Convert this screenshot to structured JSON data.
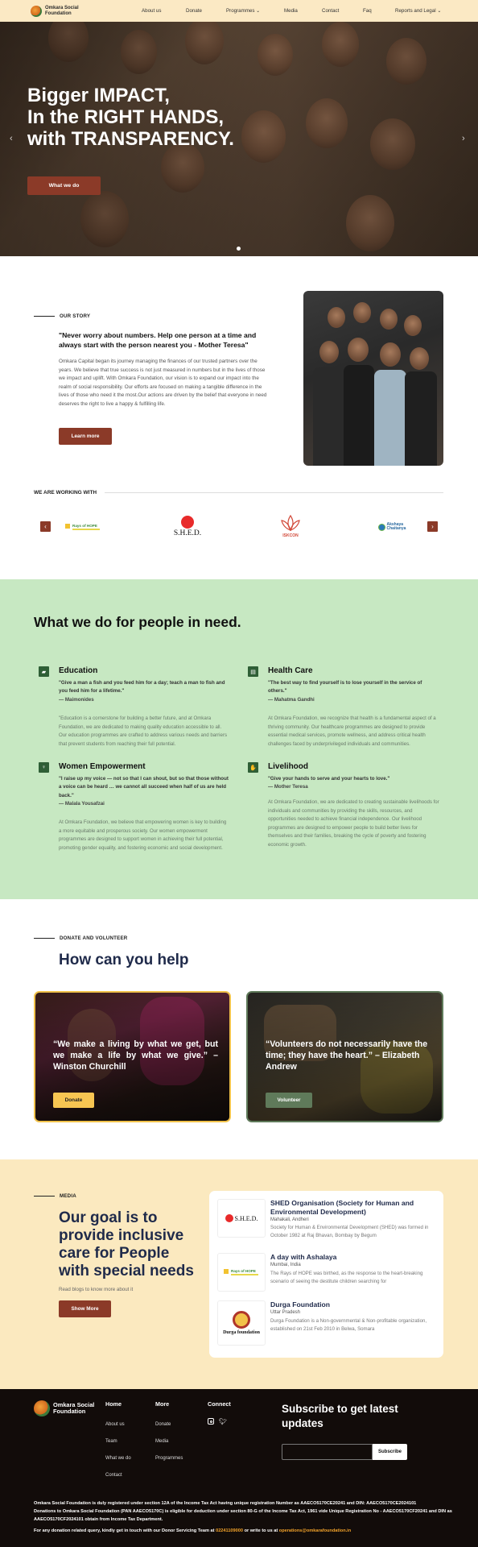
{
  "nav": {
    "logo_text": "Omkara Social Foundation",
    "items": [
      {
        "label": "About us"
      },
      {
        "label": "Donate"
      },
      {
        "label": "Programmes",
        "has_dropdown": true
      },
      {
        "label": "Media"
      },
      {
        "label": "Contact"
      },
      {
        "label": "Faq"
      },
      {
        "label": "Reports and Legal",
        "has_dropdown": true
      }
    ]
  },
  "hero": {
    "headline_1": "Bigger IMPACT,",
    "headline_2": "In the RIGHT HANDS,",
    "headline_3": "with TRANSPARENCY.",
    "cta": "What we do",
    "slides_total": 1,
    "active_slide": 1
  },
  "story": {
    "eyebrow": "OUR STORY",
    "quote": "\"Never worry about numbers. Help one person at a time and always start with the person nearest you - Mother Teresa\"",
    "body": "Omkara Capital began its journey managing the finances of our trusted partners over the years. We believe that true success is not just measured in numbers but in the lives of those we impact and uplift. With Omkara Foundation, our vision is to expand our impact into the realm of social responsibility. Our efforts are focused on making a tangible difference in the lives of those who need it the most.Our actions are driven by the belief that everyone in need deserves the right to live a happy & fulfilling life.",
    "button": "Learn more"
  },
  "partners": {
    "heading": "WE ARE WORKING WITH",
    "items": [
      {
        "name": "Rays of HOPE"
      },
      {
        "name": "S.H.E.D."
      },
      {
        "name": "ISKCON"
      },
      {
        "name": "Akshaya Chaitanya"
      }
    ]
  },
  "what_we_do": {
    "title": "What we do for people in need.",
    "areas": [
      {
        "title": "Education",
        "icon": "book-icon",
        "quote": "\"Give a man a fish and you feed him for a day; teach a man to fish and you feed him for a lifetime.\"",
        "author": "— Maimonides",
        "desc": "\"Education is a cornerstone for building a better future, and at Omkara Foundation, we are dedicated to making quality education accessible to all. Our education programmes are crafted to address various needs and barriers that prevent students from reaching their full potential."
      },
      {
        "title": "Health Care",
        "icon": "medical-kit-icon",
        "quote": "\"The best way to find yourself is to lose yourself in the service of others.\"",
        "author": "— Mahatma Gandhi",
        "desc": "At Omkara Foundation, we recognize that health is a fundamental aspect of a thriving community. Our healthcare programmes are designed to provide essential medical services, promote wellness, and address critical health challenges faced by underprivileged individuals and communities."
      },
      {
        "title": "Women Empowerment",
        "icon": "woman-icon",
        "quote": "\"I raise up my voice — not so that I can shout, but so that those without a voice can be heard … we cannot all succeed when half of us are held back.\"",
        "author": "— Malala Yousafzai",
        "desc": "At Omkara Foundation, we believe that empowering women is key to building a more equitable and prosperous society. Our women empowerment programmes are designed to support women in achieving their full potential, promoting gender equality, and fostering economic and social development."
      },
      {
        "title": "Livelihood",
        "icon": "hand-icon",
        "quote": "\"Give your hands to serve and your hearts to love.\"",
        "author": "— Mother Teresa",
        "desc": "At Omkara Foundation, we are dedicated to creating sustainable livelihoods for individuals and communities by providing the skills, resources, and opportunities needed to achieve financial independence. Our livelihood programmes are designed to empower people to build better lives for themselves and their families, breaking the cycle of poverty and fostering economic growth."
      }
    ]
  },
  "help": {
    "eyebrow": "DONATE AND VOLUNTEER",
    "title": "How can you help",
    "cards": [
      {
        "quote": "“We make a living by what we get, but we make a life by what we give.” – Winston Churchill",
        "button": "Donate"
      },
      {
        "quote": "“Volunteers do not necessarily have the time; they have the heart.” – Elizabeth Andrew",
        "button": "Volunteer"
      }
    ]
  },
  "media": {
    "eyebrow": "MEDIA",
    "title": "Our goal is to provide inclusive care for People with special needs",
    "subtitle": "Read blogs to know more about it",
    "button": "Show More",
    "posts": [
      {
        "logo": "S.H.E.D.",
        "title": "SHED Organisation (Society for Human and Environmental Development)",
        "location": "Mahakali, Andheri",
        "excerpt": "Society for Human & Environmental Development (SHED) was formed in October 1982 at Raj Bhavan, Bombay by Begum"
      },
      {
        "logo": "Rays of HOPE",
        "title": "A day with Ashalaya",
        "location": "Mumbai, India",
        "excerpt": "The Rays of HOPE was birthed, as the response to the heart-breaking scenario of seeing the destitute children searching for"
      },
      {
        "logo": "Durga foundation",
        "title": "Durga Foundation",
        "location": "Uttar Pradesh",
        "excerpt": "Durga Foundation is a Non-governmental & Non-profitable organization, established on 21st Feb 2010 in Belwa, Somara"
      }
    ]
  },
  "footer": {
    "logo_text": "Omkara Social Foundation",
    "cols": [
      {
        "heading": "Home",
        "links": [
          "About us",
          "Team",
          "What we do",
          "Contact"
        ]
      },
      {
        "heading": "More",
        "links": [
          "Donate",
          "Media",
          "Programmes"
        ]
      },
      {
        "heading": "Connect",
        "links": []
      }
    ],
    "subscribe_title": "Subscribe to get latest updates",
    "subscribe_placeholder": "",
    "subscribe_button": "Subscribe",
    "legal_1": "Omkara Social Foundation is duly registered under section 12A of the Income Tax Act having unique registration Number as AAECO5170CE20241 and DIN: AAECO5170CE2024101",
    "legal_2": "Donations to Omkara Social Foundation (PAN AAECO5170C) is eligible for deduction under section 80-G of the Income Tax Act, 1961 vide Unique Registration No - AAECO5170CF20241 and DIN as AAECO5170CF2024101 obtain from Income Tax Department.",
    "contact_prefix": "For any donation related query, kindly get in touch with our Donor Servicing Team at",
    "phone": "02241109000",
    "contact_mid": "or write to us at",
    "email": "operations@omkarafoundation.in"
  },
  "colors": {
    "nav_bg": "#fbe9c4",
    "brand": "#8b3a28",
    "green_bg": "#c7e8c2",
    "media_bg": "#fbe9bf",
    "footer_bg": "#120c0a",
    "donate_btn": "#f7c552",
    "volunteer_btn": "#5f7a5a"
  }
}
